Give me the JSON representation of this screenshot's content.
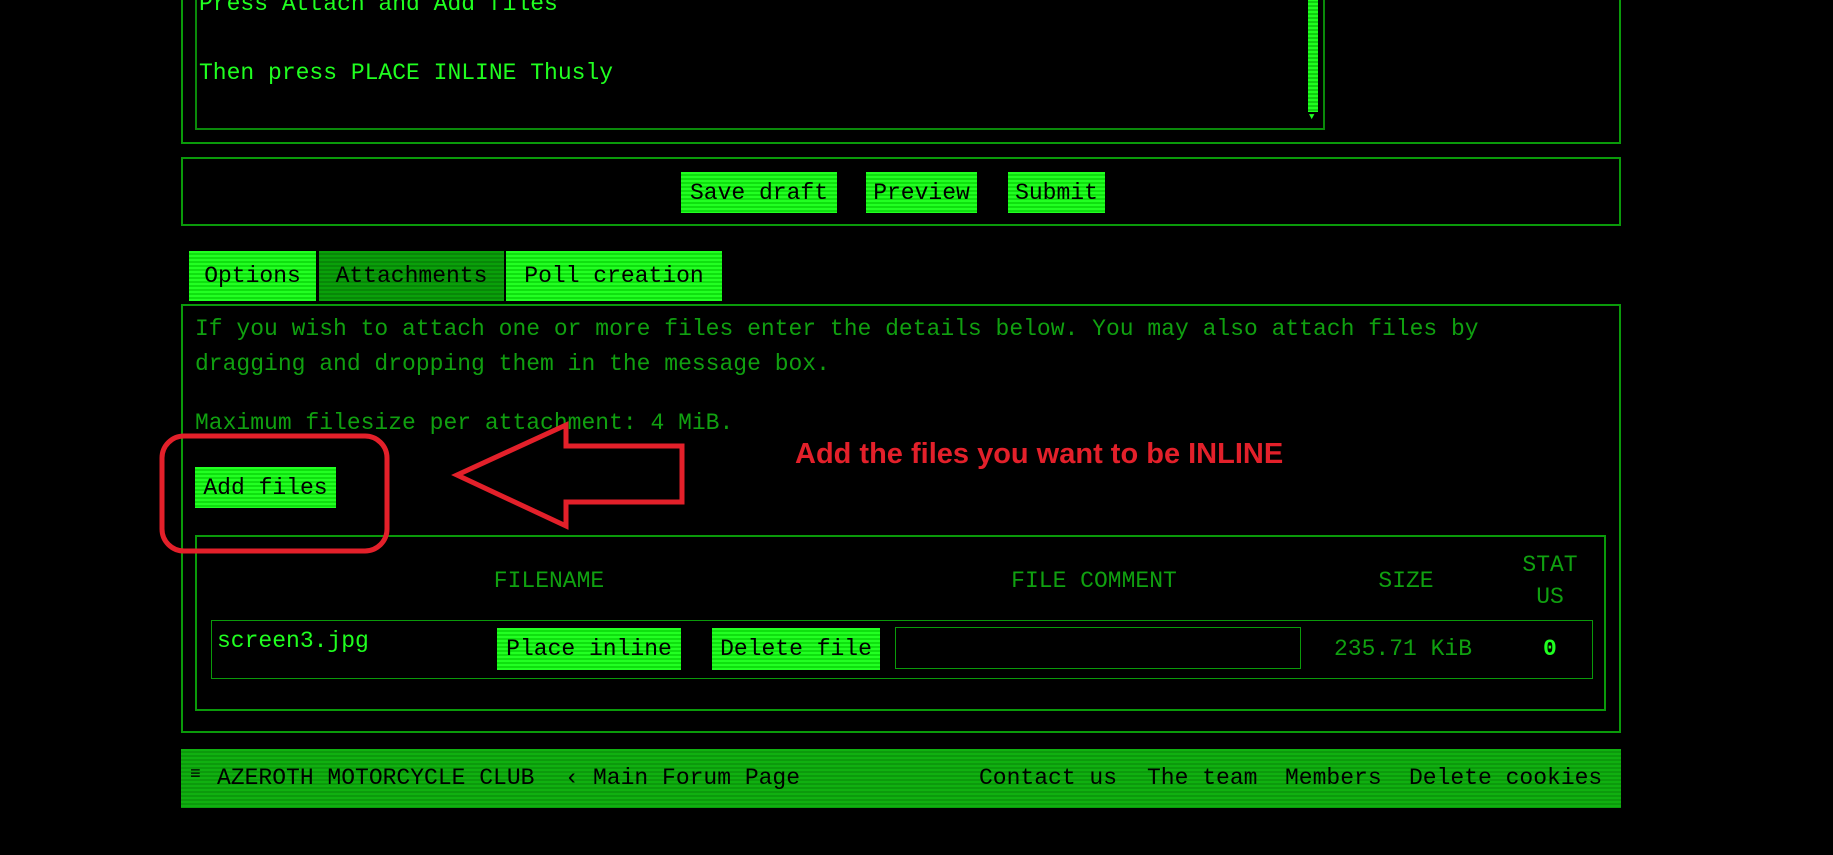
{
  "editor": {
    "lines": [
      "Press Attach and Add files",
      "Then press PLACE INLINE  Thusly"
    ]
  },
  "actions": {
    "save_draft": "Save draft",
    "preview": "Preview",
    "submit": "Submit"
  },
  "tabs": [
    {
      "label": "Options",
      "active": false
    },
    {
      "label": "Attachments",
      "active": true
    },
    {
      "label": "Poll creation",
      "active": false
    }
  ],
  "attachments": {
    "intro_line1": "If you wish to attach one or more files enter the details below. You may also attach files by",
    "intro_line2": "dragging and dropping them in the message box.",
    "max_size": "Maximum filesize per attachment: 4 MiB.",
    "add_files": "Add files",
    "headers": {
      "filename": "FILENAME",
      "comment": "FILE COMMENT",
      "size": "SIZE",
      "status_1": "STAT",
      "status_2": "US"
    },
    "rows": [
      {
        "filename": "screen3.jpg",
        "place_inline": "Place inline",
        "delete": "Delete file",
        "comment": "",
        "size": "235.71 KiB",
        "status": "0"
      }
    ]
  },
  "annotation": {
    "text": "Add the files you want to be INLINE",
    "color": "#e3202a"
  },
  "footer": {
    "menu_icon": "≡",
    "site": "AZEROTH MOTORCYCLE CLUB",
    "separator": "‹",
    "forum": "Main Forum Page",
    "links": [
      "Contact us",
      "The team",
      "Members",
      "Delete cookies"
    ]
  }
}
